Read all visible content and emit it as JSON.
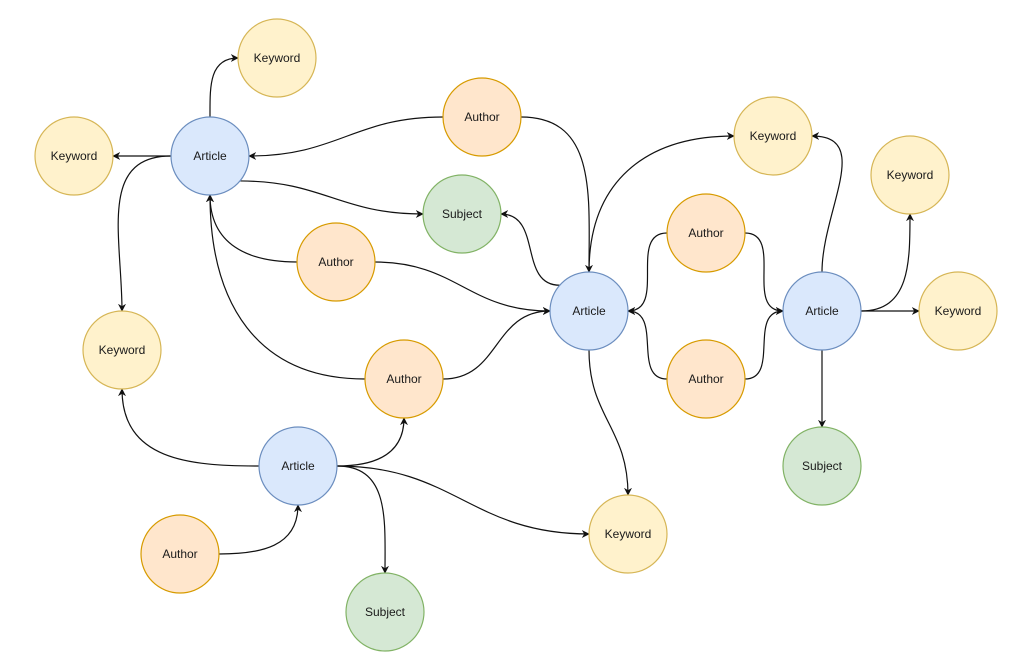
{
  "node_types": {
    "Article": {
      "fill": "#dae8fc",
      "stroke": "#6c8ebf"
    },
    "Author": {
      "fill": "#ffe6cc",
      "stroke": "#d79b00"
    },
    "Keyword": {
      "fill": "#fff2cc",
      "stroke": "#d6b656"
    },
    "Subject": {
      "fill": "#d5e8d4",
      "stroke": "#82b366"
    }
  },
  "nodes": [
    {
      "id": "K1",
      "label": "Keyword"
    },
    {
      "id": "K2",
      "label": "Keyword"
    },
    {
      "id": "A1",
      "label": "Article"
    },
    {
      "id": "Au1",
      "label": "Author"
    },
    {
      "id": "S1",
      "label": "Subject"
    },
    {
      "id": "Au2",
      "label": "Author"
    },
    {
      "id": "K3",
      "label": "Keyword"
    },
    {
      "id": "Au3",
      "label": "Author"
    },
    {
      "id": "A2",
      "label": "Article"
    },
    {
      "id": "Au4",
      "label": "Author"
    },
    {
      "id": "S2",
      "label": "Subject"
    },
    {
      "id": "A3",
      "label": "Article"
    },
    {
      "id": "K4",
      "label": "Keyword"
    },
    {
      "id": "Au5",
      "label": "Author"
    },
    {
      "id": "Au6",
      "label": "Author"
    },
    {
      "id": "A4",
      "label": "Article"
    },
    {
      "id": "K5",
      "label": "Keyword"
    },
    {
      "id": "K6",
      "label": "Keyword"
    },
    {
      "id": "S3",
      "label": "Subject"
    },
    {
      "id": "K7",
      "label": "Keyword"
    }
  ],
  "edges": [
    {
      "from": "A1",
      "to": "K1"
    },
    {
      "from": "A1",
      "to": "K2"
    },
    {
      "from": "Au1",
      "to": "A1"
    },
    {
      "from": "A1",
      "to": "S1"
    },
    {
      "from": "A1",
      "to": "K3"
    },
    {
      "from": "Au2",
      "to": "A1"
    },
    {
      "from": "Au3",
      "to": "A1"
    },
    {
      "from": "Au2",
      "to": "A3"
    },
    {
      "from": "Au1",
      "to": "A3"
    },
    {
      "from": "A3",
      "to": "S1"
    },
    {
      "from": "Au3",
      "to": "A3"
    },
    {
      "from": "A3",
      "to": "K4"
    },
    {
      "from": "Au5",
      "to": "A3"
    },
    {
      "from": "Au6",
      "to": "A3"
    },
    {
      "from": "Au5",
      "to": "A4"
    },
    {
      "from": "Au6",
      "to": "A4"
    },
    {
      "from": "A4",
      "to": "K4"
    },
    {
      "from": "A4",
      "to": "K5"
    },
    {
      "from": "A4",
      "to": "K6"
    },
    {
      "from": "A4",
      "to": "S3"
    },
    {
      "from": "A3",
      "to": "K7"
    },
    {
      "from": "A2",
      "to": "K3"
    },
    {
      "from": "A2",
      "to": "Au3"
    },
    {
      "from": "A2",
      "to": "S2"
    },
    {
      "from": "A2",
      "to": "K7"
    },
    {
      "from": "Au4",
      "to": "A2"
    }
  ]
}
